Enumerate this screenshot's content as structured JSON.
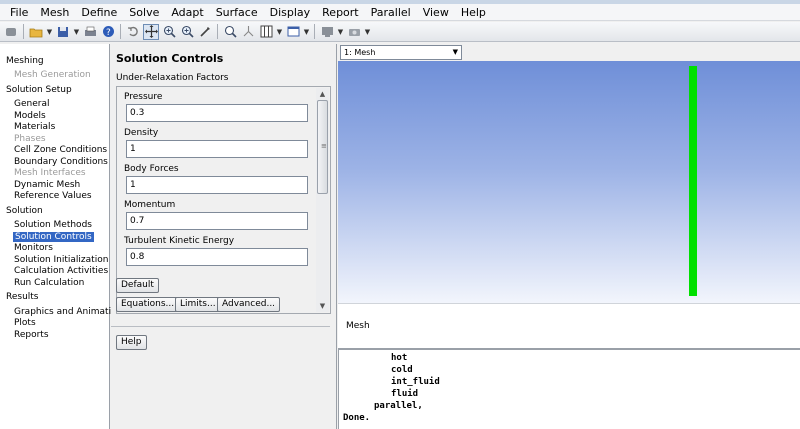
{
  "menu": [
    "File",
    "Mesh",
    "Define",
    "Solve",
    "Adapt",
    "Surface",
    "Display",
    "Report",
    "Parallel",
    "View",
    "Help"
  ],
  "toolbar_icons": [
    "mesh-load-icon",
    "open-folder-icon",
    "save-icon",
    "print-icon",
    "help-icon",
    "rotate-icon",
    "pan-icon",
    "zoom-in-icon",
    "zoom-fit-icon",
    "probe-icon",
    "zoom-box-icon",
    "orient-icon",
    "layout-icon",
    "window-icon",
    "display-icon",
    "camera-icon"
  ],
  "nav": {
    "sections": [
      {
        "label": "Meshing",
        "items": [
          {
            "label": "Mesh Generation",
            "state": "disabled"
          }
        ]
      },
      {
        "label": "Solution Setup",
        "items": [
          {
            "label": "General"
          },
          {
            "label": "Models"
          },
          {
            "label": "Materials"
          },
          {
            "label": "Phases",
            "state": "disabled"
          },
          {
            "label": "Cell Zone Conditions"
          },
          {
            "label": "Boundary Conditions"
          },
          {
            "label": "Mesh Interfaces",
            "state": "disabled"
          },
          {
            "label": "Dynamic Mesh"
          },
          {
            "label": "Reference Values"
          }
        ]
      },
      {
        "label": "Solution",
        "items": [
          {
            "label": "Solution Methods"
          },
          {
            "label": "Solution Controls",
            "state": "selected"
          },
          {
            "label": "Monitors"
          },
          {
            "label": "Solution Initialization"
          },
          {
            "label": "Calculation Activities"
          },
          {
            "label": "Run Calculation"
          }
        ]
      },
      {
        "label": "Results",
        "items": [
          {
            "label": "Graphics and Animations"
          },
          {
            "label": "Plots"
          },
          {
            "label": "Reports"
          }
        ]
      }
    ]
  },
  "panel": {
    "title": "Solution Controls",
    "group_label": "Under-Relaxation Factors",
    "fields": [
      {
        "label": "Pressure",
        "value": "0.3"
      },
      {
        "label": "Density",
        "value": "1"
      },
      {
        "label": "Body Forces",
        "value": "1"
      },
      {
        "label": "Momentum",
        "value": "0.7"
      },
      {
        "label": "Turbulent Kinetic Energy",
        "value": "0.8"
      }
    ],
    "default_button": "Default",
    "equations_button": "Equations...",
    "limits_button": "Limits...",
    "advanced_button": "Advanced...",
    "help_button": "Help"
  },
  "graphics": {
    "window_select": "1: Mesh",
    "caption": "Mesh",
    "mesh_color": "#00e000"
  },
  "console": {
    "lines": [
      {
        "text": "hot",
        "indent": 3
      },
      {
        "text": "cold",
        "indent": 3
      },
      {
        "text": "int_fluid",
        "indent": 3
      },
      {
        "text": "fluid",
        "indent": 3
      },
      {
        "text": "parallel,",
        "indent": 2
      },
      {
        "text": "Done.",
        "indent": 0
      }
    ]
  }
}
